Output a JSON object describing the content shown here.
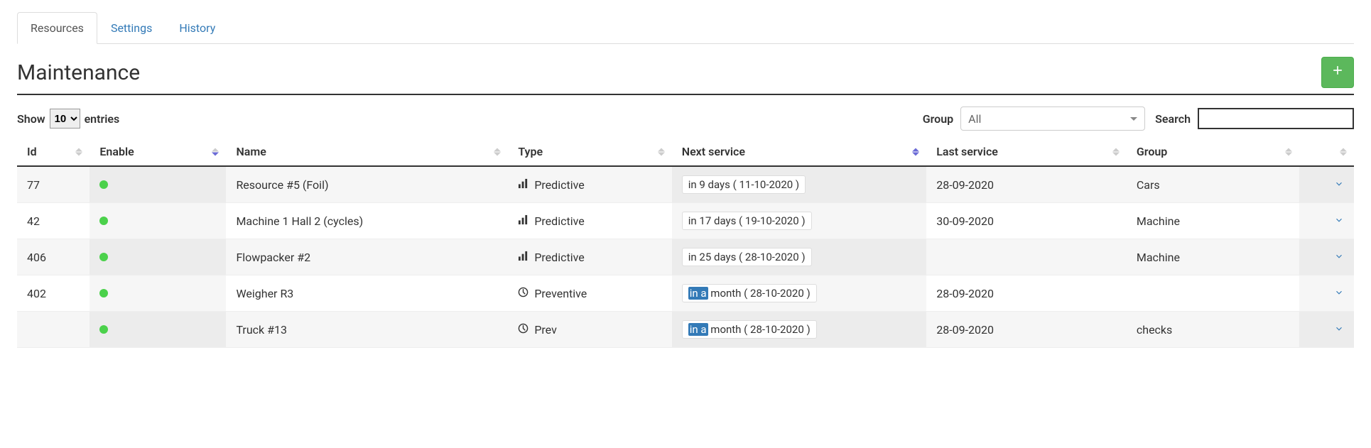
{
  "tabs": [
    {
      "label": "Resources",
      "active": true
    },
    {
      "label": "Settings",
      "active": false
    },
    {
      "label": "History",
      "active": false
    }
  ],
  "page_title": "Maintenance",
  "controls": {
    "show_label_pre": "Show",
    "show_value": "10",
    "show_label_post": "entries",
    "group_label": "Group",
    "group_selected": "All",
    "search_label": "Search",
    "search_value": ""
  },
  "columns": {
    "id": "Id",
    "enable": "Enable",
    "name": "Name",
    "type": "Type",
    "next": "Next service",
    "last": "Last service",
    "group": "Group"
  },
  "rows": [
    {
      "id": "77",
      "enabled": true,
      "name": "Resource #5 (Foil)",
      "type_icon": "bar",
      "type": "Predictive",
      "next_prefix": "",
      "next_hl": "",
      "next_rest": "in 9 days ( 11-10-2020 )",
      "last": "28-09-2020",
      "group": "Cars"
    },
    {
      "id": "42",
      "enabled": true,
      "name": "Machine 1 Hall 2 (cycles)",
      "type_icon": "bar",
      "type": "Predictive",
      "next_prefix": "",
      "next_hl": "",
      "next_rest": "in 17 days ( 19-10-2020 )",
      "last": "30-09-2020",
      "group": "Machine"
    },
    {
      "id": "406",
      "enabled": true,
      "name": "Flowpacker #2",
      "type_icon": "bar",
      "type": "Predictive",
      "next_prefix": "",
      "next_hl": "",
      "next_rest": "in 25 days ( 28-10-2020 )",
      "last": "",
      "group": "Machine"
    },
    {
      "id": "402",
      "enabled": true,
      "name": "Weigher R3",
      "type_icon": "clock",
      "type": "Preventive",
      "next_prefix": "",
      "next_hl": "in a",
      "next_rest": " month ( 28-10-2020 )",
      "last": "28-09-2020",
      "group": ""
    },
    {
      "id": "",
      "enabled": true,
      "name": "Truck #13",
      "type_icon": "clock",
      "type": "Prev",
      "next_prefix": "",
      "next_hl": "in a",
      "next_rest": " month ( 28-10-2020 )",
      "last": "28-09-2020",
      "group": "checks"
    }
  ]
}
